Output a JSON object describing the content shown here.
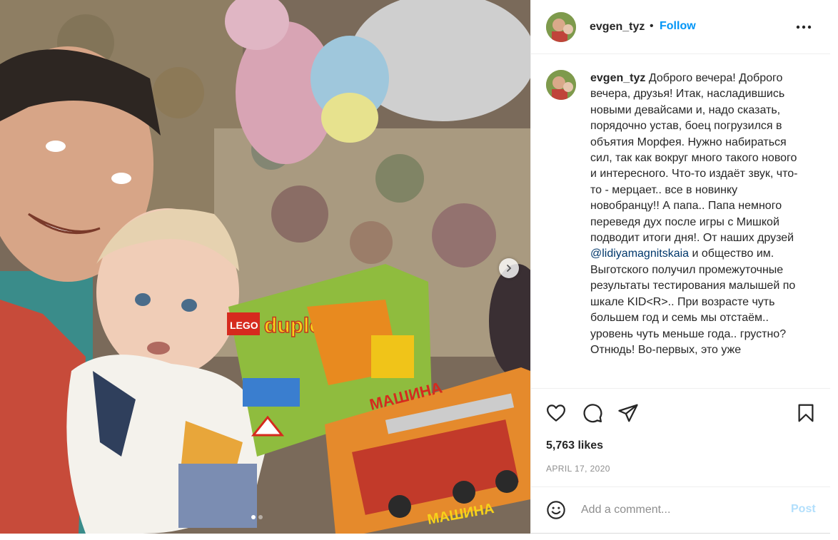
{
  "post": {
    "username": "evgen_tyz",
    "separator": "•",
    "follow_label": "Follow",
    "more_icon": "more-horizontal-icon",
    "caption_parts": [
      "Доброго вечера! Доброго вечера, друзья! Итак, насладившись новыми девайсами и, надо сказать, порядочно устав, боец погрузился в объятия Морфея. Нужно набираться сил, так как вокруг много такого нового и интересного. Что-то издаёт звук, что-то - мерцает.. все в новинку новобранцу!! А папа.. Папа немного переведя дух после игры с Мишкой подводит итоги дня!. От наших друзей ",
      "@lidiyamagnitskaia",
      " и общество им. Выготского получил промежуточные результаты тестирования малышей по шкале KID<R>.. При возрасте чуть большем год и семь мы отстаём.. уровень чуть меньше года.. грустно? Отнюдь! Во-первых, это уже"
    ],
    "likes": "5,763 likes",
    "date": "APRIL 17, 2020",
    "carousel": {
      "slides": 2,
      "active_slide": 1
    }
  },
  "actions": {
    "like_icon": "heart-icon",
    "comment_icon": "comment-icon",
    "share_icon": "paper-plane-icon",
    "save_icon": "bookmark-icon"
  },
  "comment": {
    "emoji_icon": "smiley-icon",
    "placeholder": "Add a comment...",
    "post_label": "Post"
  },
  "colors": {
    "link_blue": "#0095f6",
    "mention": "#00376b",
    "post_disabled": "#b2dffc",
    "muted": "#8e8e8e",
    "text": "#262626"
  }
}
